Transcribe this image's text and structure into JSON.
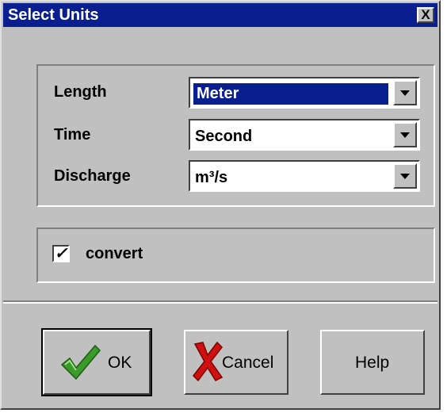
{
  "window": {
    "title": "Select Units",
    "close_label": "X"
  },
  "units": {
    "rows": [
      {
        "label": "Length",
        "value": "Meter"
      },
      {
        "label": "Time",
        "value": "Second"
      },
      {
        "label": "Discharge",
        "value": "m³/s"
      }
    ]
  },
  "convert": {
    "label": "convert",
    "checked_mark": "✓"
  },
  "buttons": {
    "ok": "OK",
    "cancel": "Cancel",
    "help": "Help"
  },
  "icons": {
    "ok": "green-checkmark-icon",
    "cancel": "red-x-icon"
  },
  "colors": {
    "titlebar": "#0a1f8f",
    "check_icon": "#3a9a2a",
    "cancel_icon": "#d01010"
  }
}
